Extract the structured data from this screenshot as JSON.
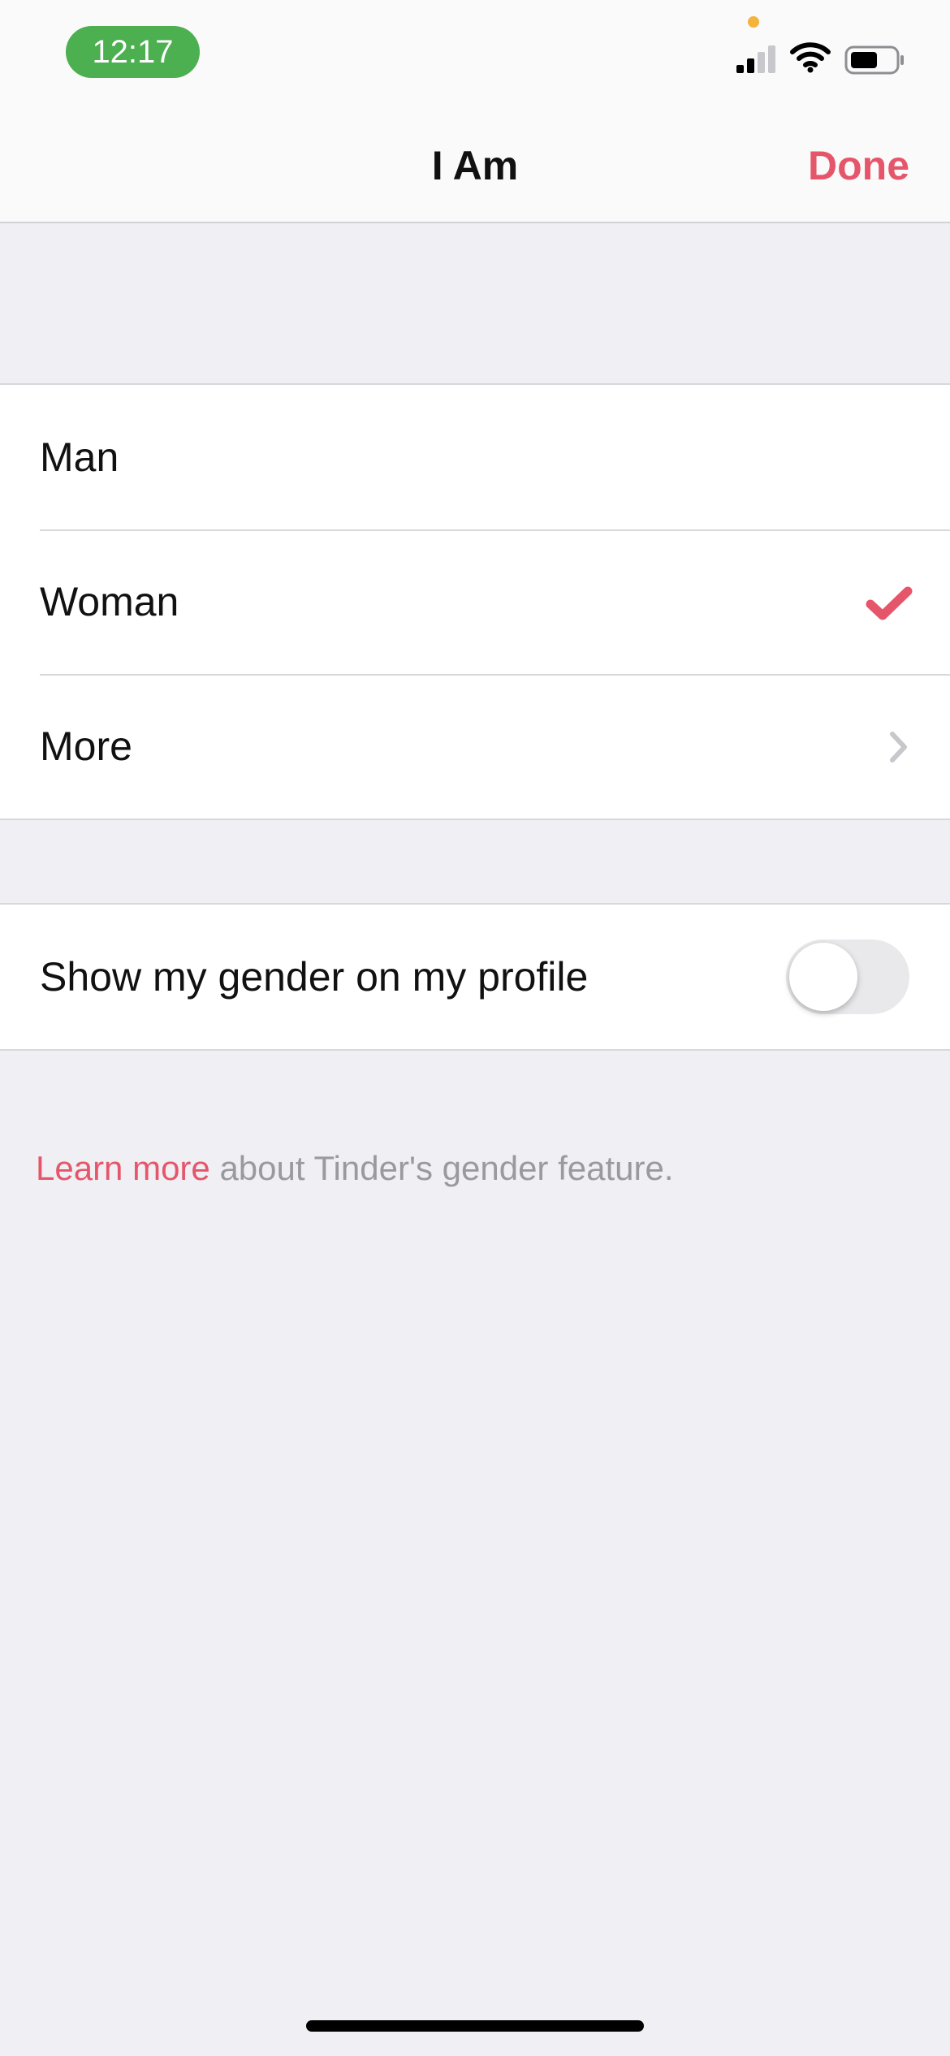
{
  "status_bar": {
    "time": "12:17",
    "signal_icon": "cellular-signal-icon",
    "wifi_icon": "wifi-icon",
    "battery_icon": "battery-icon",
    "accent_color": "#4caf50"
  },
  "nav": {
    "title": "I Am",
    "done_label": "Done",
    "accent_color": "#e5566b"
  },
  "gender_options": [
    {
      "label": "Man",
      "selected": false,
      "accessory": "none"
    },
    {
      "label": "Woman",
      "selected": true,
      "accessory": "checkmark-icon"
    },
    {
      "label": "More",
      "selected": false,
      "accessory": "chevron-right-icon"
    }
  ],
  "show_gender": {
    "label": "Show my gender on my profile",
    "enabled": false
  },
  "footnote": {
    "link_text": "Learn more",
    "text": " about Tinder's gender feature."
  }
}
